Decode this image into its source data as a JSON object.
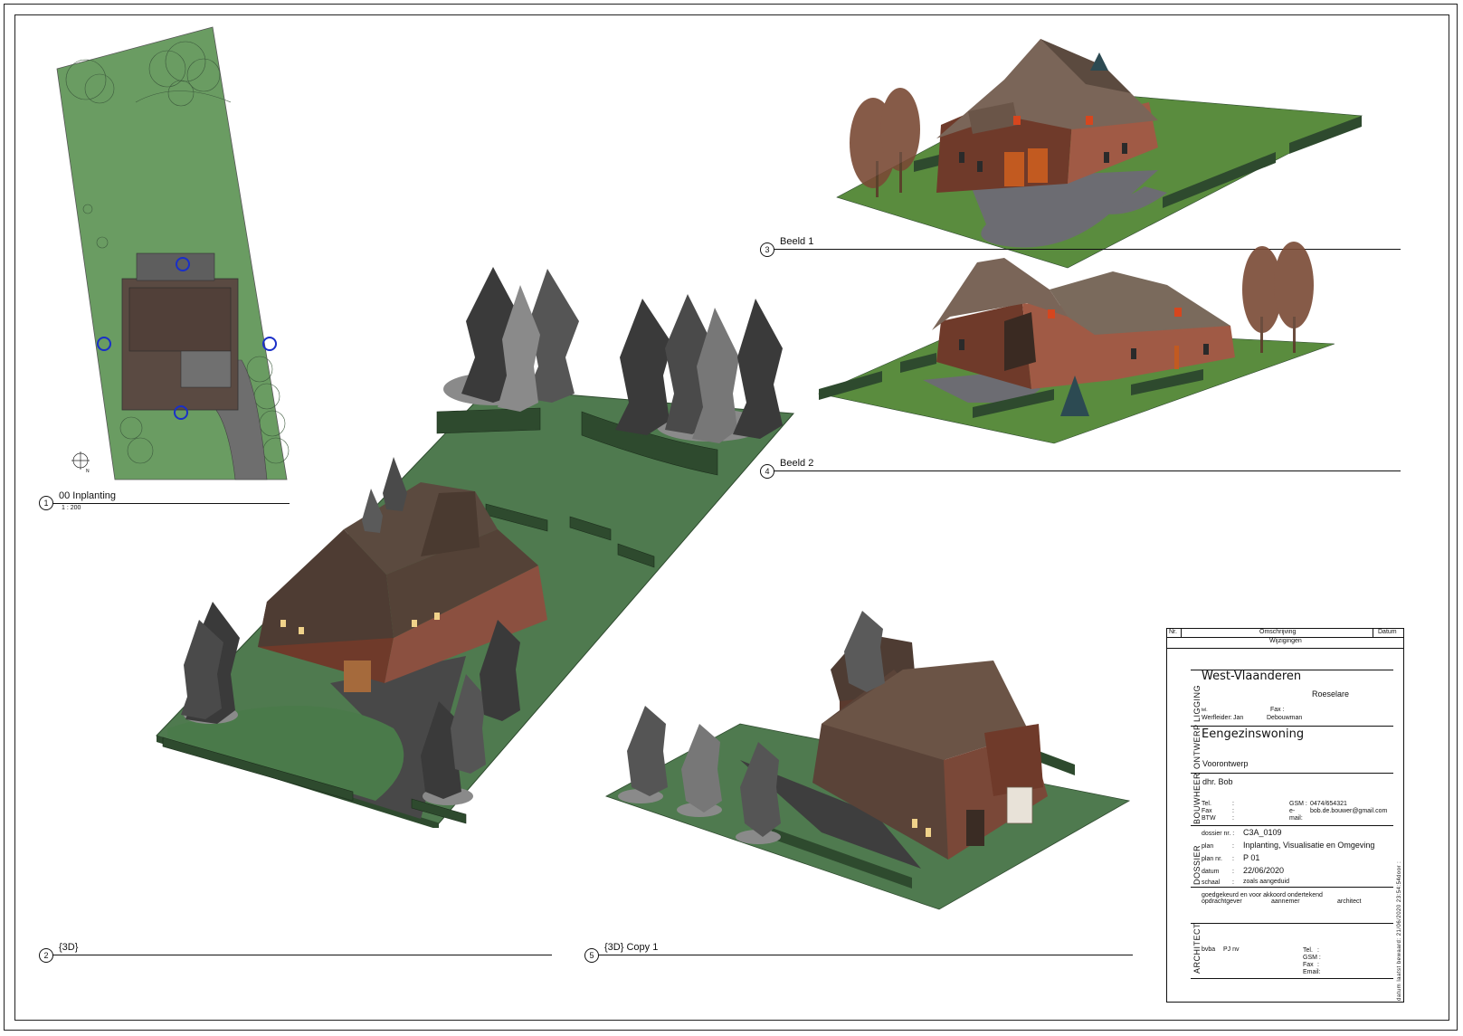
{
  "viewports": {
    "v1": {
      "number": "1",
      "title": "00 Inplanting",
      "scale": "1 : 200"
    },
    "v2": {
      "number": "2",
      "title": "{3D}"
    },
    "v3": {
      "number": "3",
      "title": "Beeld 1"
    },
    "v4": {
      "number": "4",
      "title": "Beeld 2"
    },
    "v5": {
      "number": "5",
      "title": "{3D} Copy 1"
    }
  },
  "plan_marks": {
    "north": "N",
    "m1": "1",
    "m2": "1",
    "m3": "1",
    "m4": "1"
  },
  "revisions": {
    "col_nr": "Nr.",
    "col_desc": "Omschrijving",
    "col_date": "Datum",
    "footer": "Wijzigingen"
  },
  "titleblock": {
    "ligging": {
      "section": "LIGGING",
      "province": "West-Vlaanderen",
      "city": "Roeselare",
      "tel_label": "tel.",
      "fax_label": "Fax :",
      "leader_label": "Werfleider:",
      "leader_first": "Jan",
      "leader_last": "Debouwman"
    },
    "ontwerp": {
      "section": "ONTWERP",
      "title": "Eengezinswoning",
      "phase": "Voorontwerp"
    },
    "bouwheer": {
      "section": "BOUWHEER",
      "name": "dhr. Bob",
      "tel": "Tel.",
      "fax": "Fax",
      "btw": "BTW",
      "colon": ":",
      "gsm_label": "GSM :",
      "gsm": "0474/654321",
      "email_label": "e-",
      "email_label2": "mail:",
      "email": "bob.de.bouwer@gmail.com"
    },
    "dossier": {
      "section": "DOSSIER",
      "dossier_label": "dossier nr. :",
      "dossier": "C3A_0109",
      "plan_label": "plan",
      "plan": "Inplanting, Visualisatie en Omgeving",
      "plannr_label": "plan nr.",
      "plannr": "P 01",
      "datum_label": "datum",
      "datum": "22/06/2020",
      "schaal_label": "schaal",
      "schaal": "zoals aangeduid",
      "colon": ":"
    },
    "approval": {
      "text": "goedgekeurd en voor akkoord ondertekend",
      "opdrachtgever": "opdrachtgever",
      "aannemer": "aannemer",
      "architect": "architect"
    },
    "architect": {
      "section": "ARCHITECT",
      "firm": "bvba",
      "name": "PJ nv",
      "tel": "Tel.",
      "gsm": "GSM :",
      "fax": "Fax",
      "email": "Email:",
      "colon": ":"
    },
    "side_stamp": "datum laatst bewaard: 21/06/2020 23:54:54",
    "door": "door :"
  },
  "colors": {
    "grass": "#4f7a4f",
    "grass_light": "#6a9c62",
    "roof": "#5b4a3f",
    "brick": "#8b4a35",
    "tree_dark": "#3a3a3a",
    "tree_light": "#8a8a8a",
    "pavement": "#4a4a4a",
    "marker_blue": "#1a2fc8"
  }
}
